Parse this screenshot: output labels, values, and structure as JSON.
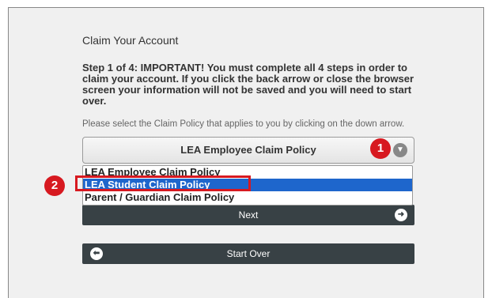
{
  "page": {
    "title": "Claim Your Account",
    "step_text": "Step 1 of 4: IMPORTANT! You must complete all 4 steps in order to claim your account. If you click the back arrow or close the browser screen your information will not be saved and you will need to start over.",
    "hint": "Please select the Claim Policy that applies to you by clicking on the down arrow."
  },
  "select": {
    "value": "LEA Employee Claim Policy",
    "arrow_icon": "chevron-down-icon",
    "options": [
      {
        "label": "LEA Employee Claim Policy"
      },
      {
        "label": "LEA Student Claim Policy"
      },
      {
        "label": "Parent / Guardian Claim Policy"
      }
    ],
    "highlighted_option": "LEA Student Claim Policy"
  },
  "buttons": {
    "next_label": "Next",
    "next_icon": "arrow-right-icon",
    "start_over_label": "Start Over",
    "start_over_icon": "arrow-left-icon"
  },
  "annotations": {
    "badge_1": "1",
    "badge_2": "2",
    "color": "#d71920"
  },
  "colors": {
    "selected_option": "#1e66cc",
    "button_bg": "#384145"
  }
}
